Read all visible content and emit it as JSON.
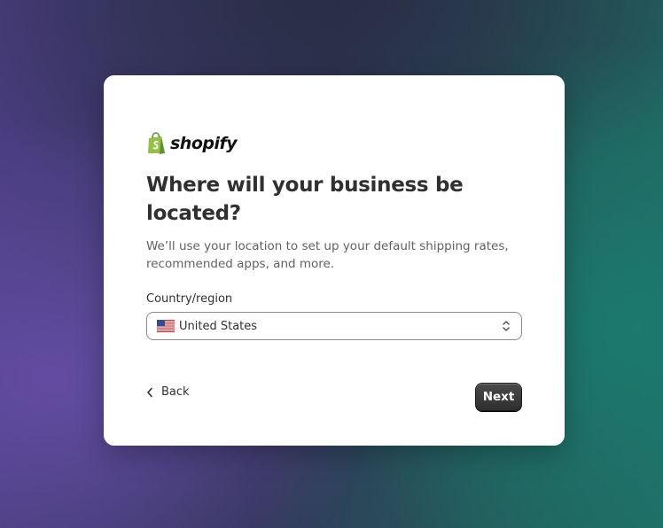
{
  "brand": {
    "name": "shopify",
    "accent_color": "#95bf47"
  },
  "page": {
    "title": "Where will your business be located?",
    "subtitle": "We’ll use your location to set up your default shipping rates, recommended apps, and more."
  },
  "country_field": {
    "label": "Country/region",
    "selected_value": "United States",
    "flag_icon": "us-flag-icon"
  },
  "actions": {
    "back_label": "Back",
    "next_label": "Next"
  }
}
